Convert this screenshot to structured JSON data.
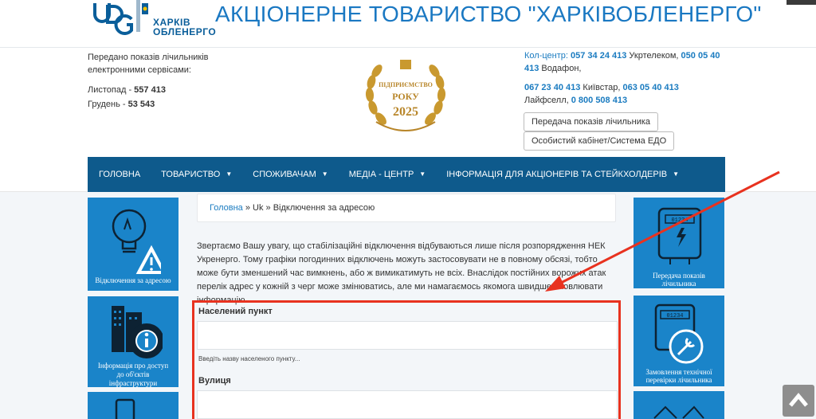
{
  "header": {
    "logo_monogram": "OBG",
    "logo_line1": "ХАРКІВ",
    "logo_line2": "ОБЛЕНЕРГО",
    "company_title": "АКЦІОНЕРНЕ ТОВАРИСТВО \"ХАРКІВОБЛЕНЕРГО\""
  },
  "meter_stats": {
    "intro": "Передано показів лічильників електронними сервісами:",
    "month1_label": "Листопад - ",
    "month1_value": "557 413",
    "month2_label": "Грудень - ",
    "month2_value": "53 543"
  },
  "award": {
    "line1": "ПІДПРИЄМСТВО",
    "line2": "РОКУ",
    "year": "2025"
  },
  "contacts": {
    "callcenter_label": "Кол-центр:",
    "phone1": "057 34 24 413",
    "op1": " Укртелеком, ",
    "phone2": "050 05 40 413",
    "op2": " Водафон,",
    "phone3": "067 23 40 413",
    "op3": " Київстар, ",
    "phone4": "063 05 40 413",
    "op4": " Лайфселл, ",
    "phone5": "0 800 508 413"
  },
  "buttons": {
    "meter_submit": "Передача показів лічильника",
    "cabinet": "Особистий кабінет/Система ЕДО"
  },
  "nav": {
    "items": [
      {
        "label": "ГОЛОВНА",
        "dropdown": false
      },
      {
        "label": "ТОВАРИСТВО",
        "dropdown": true
      },
      {
        "label": "СПОЖИВАЧАМ",
        "dropdown": true
      },
      {
        "label": "МЕДІА - ЦЕНТР",
        "dropdown": true
      },
      {
        "label": "ІНФОРМАЦІЯ ДЛЯ АКЦІОНЕРІВ ТА СТЕЙКХОЛДЕРІВ",
        "dropdown": true
      }
    ],
    "caret": "▼"
  },
  "left_tiles": {
    "outages": "Відключення за адресою",
    "infra_line1": "Інформація про доступ",
    "infra_line2": "до об'єктів",
    "infra_line3": "інфраструктури"
  },
  "right_tiles": {
    "meter_line1": "Передача показів",
    "meter_line2": "лічильника",
    "meter_digits": "01234",
    "check_line1": "Замовлення  технічної",
    "check_line2": "перевірки лічильника"
  },
  "breadcrumb": {
    "home": "Головна",
    "sep": " » ",
    "lang": "Uk",
    "current": "Відключення за адресою"
  },
  "notice": "Звертаємо Вашу увагу, що стабілізаційні відключення відбуваються лише після розпорядження НЕК Укренерго. Тому графіки погодинних відключень можуть застосовувати не в повному обсязі, тобто може бути зменшений час вимкнень, або ж вимикатимуть не всіх. Внаслідок постійних ворожих атак перелік адрес у кожній з черг може змінюватись, але ми намагаємось якомога швидше оновлювати інформацію.",
  "form": {
    "city_label": "Населений пункт",
    "city_value": "",
    "city_hint": "Введіть назву населеного пункту...",
    "street_label": "Вулиця",
    "street_value": ""
  },
  "colors": {
    "brand_blue": "#1a78c2",
    "nav_blue": "#0e5a8c",
    "tile_blue": "#1a84c9",
    "highlight_red": "#e8321f"
  },
  "icons": {
    "scroll_top": "chevron-up-icon"
  }
}
